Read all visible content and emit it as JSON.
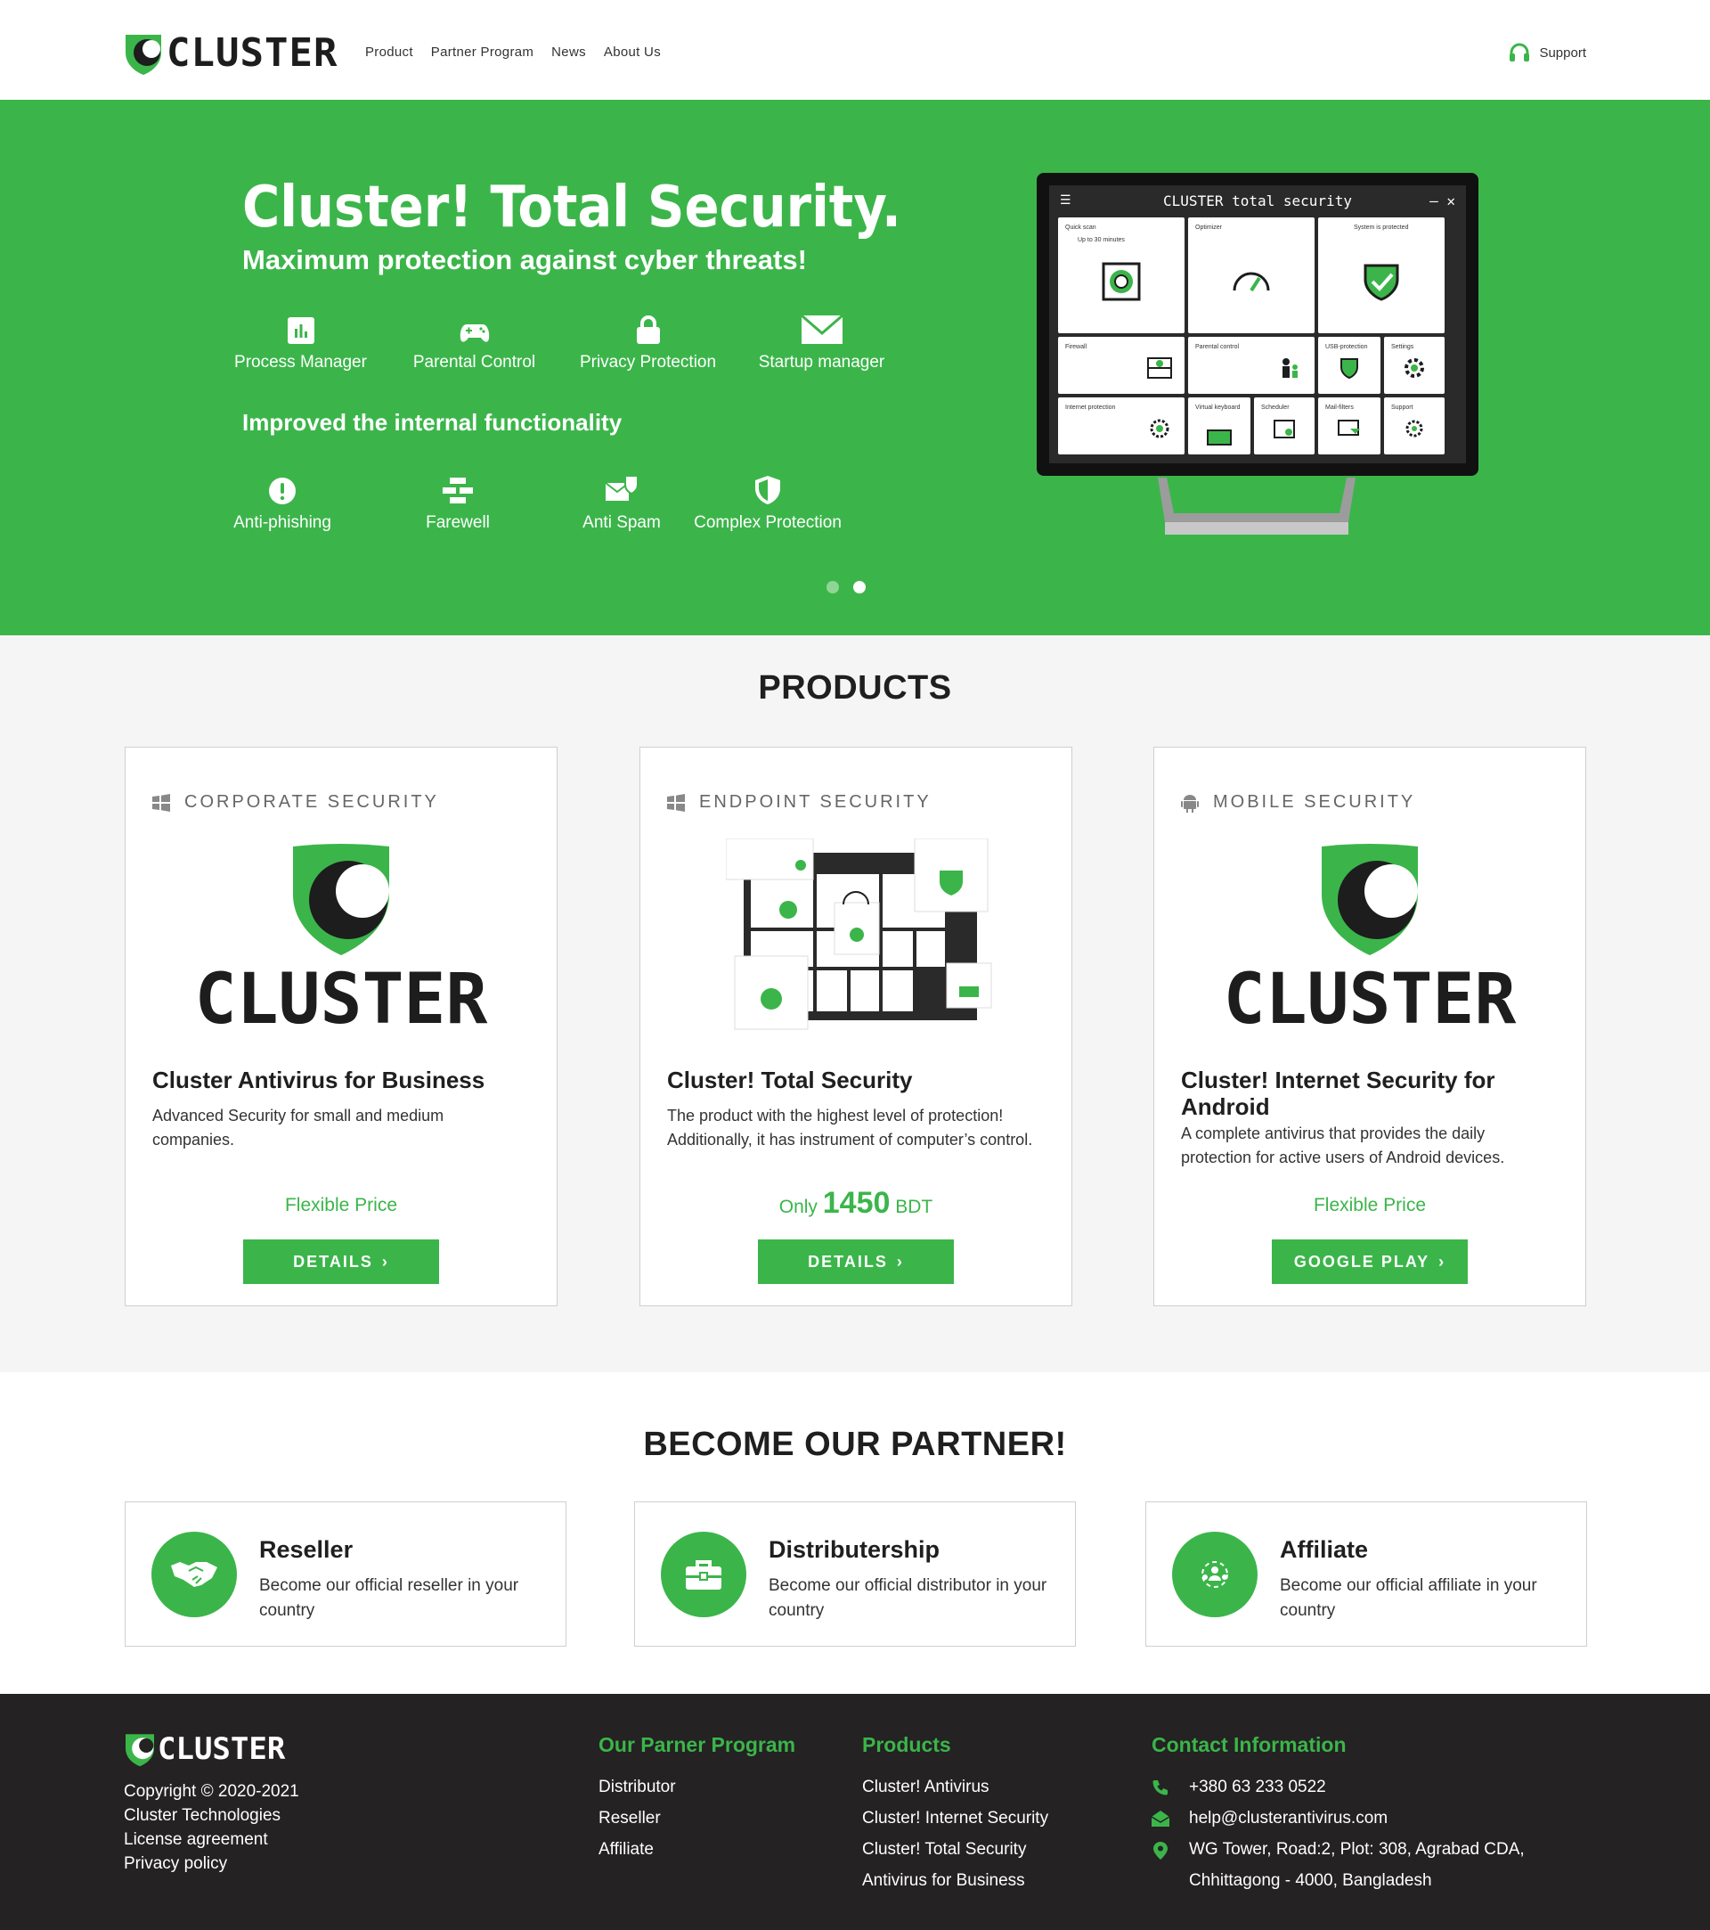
{
  "header": {
    "logo_text": "CLUSTER",
    "nav": [
      "Product",
      "Partner Program",
      "News",
      "About Us"
    ],
    "support_label": "Support"
  },
  "hero": {
    "title": "Cluster! Total Security.",
    "subtitle": "Maximum protection against cyber threats!",
    "features_top": [
      {
        "label": "Process Manager",
        "icon": "chart-icon"
      },
      {
        "label": "Parental Control",
        "icon": "gamepad-icon"
      },
      {
        "label": "Privacy Protection",
        "icon": "lock-icon"
      },
      {
        "label": "Startup manager",
        "icon": "envelope-icon"
      }
    ],
    "subtitle2": "Improved the internal functionality",
    "features_bottom": [
      {
        "label": "Anti-phishing",
        "icon": "alert-icon"
      },
      {
        "label": "Farewell",
        "icon": "firewall-icon"
      },
      {
        "label": "Anti Spam",
        "icon": "mail-shield-icon"
      },
      {
        "label": "Complex Protection",
        "icon": "shield-icon"
      }
    ],
    "monitor": {
      "title": "CLUSTER total security",
      "tiles": [
        "Quick scan",
        "Up to 30 minutes",
        "Optimizer",
        "System is protected",
        "Firewall",
        "Parental control",
        "USB-protection",
        "Settings",
        "Internet protection",
        "Virtual keyboard",
        "Scheduler",
        "Mail-filters",
        "Support"
      ]
    },
    "carousel_active": 1
  },
  "products": {
    "title": "PRODUCTS",
    "cards": [
      {
        "category": "CORPORATE SECURITY",
        "category_icon": "windows-icon",
        "name": "Cluster Antivirus for Business",
        "desc": "Advanced Security for small and medium companies.",
        "price_text": "Flexible Price",
        "button": "DETAILS"
      },
      {
        "category": "ENDPOINT SECURITY",
        "category_icon": "windows-icon",
        "name": "Cluster! Total Security",
        "desc": "The product with the highest level of protection! Additionally, it has instrument of computer’s control.",
        "price_prefix": "Only",
        "price_value": "1450",
        "price_currency": "BDT",
        "button": "DETAILS"
      },
      {
        "category": "MOBILE SECURITY",
        "category_icon": "android-icon",
        "name": "Cluster! Internet Security for Android",
        "desc": "A complete antivirus that provides the daily protection for active users of Android devices.",
        "price_text": "Flexible Price",
        "button": "GOOGLE PLAY"
      }
    ],
    "logo_text": "CLUSTER"
  },
  "partner": {
    "title": "BECOME OUR PARTNER!",
    "cards": [
      {
        "title": "Reseller",
        "desc": "Become our official reseller in your country",
        "icon": "handshake-icon"
      },
      {
        "title": "Distributership",
        "desc": "Become our official distributor in your country",
        "icon": "briefcase-icon"
      },
      {
        "title": "Affiliate",
        "desc": "Become our official affiliate in your country",
        "icon": "network-icon"
      }
    ]
  },
  "footer": {
    "logo_text": "CLUSTER",
    "copyright": [
      "Copyright © 2020-2021",
      "Cluster Technologies",
      "License agreement",
      "Privacy policy"
    ],
    "col1": {
      "title": "Our Parner Program",
      "links": [
        "Distributor",
        "Reseller",
        "Affiliate"
      ]
    },
    "col2": {
      "title": "Products",
      "links": [
        "Cluster! Antivirus",
        "Cluster! Internet Security",
        "Cluster! Total Security",
        "Antivirus for Business"
      ]
    },
    "col3": {
      "title": "Contact Information",
      "phone": "+380 63 233 0522",
      "email": "help@clusterantivirus.com",
      "address1": "WG Tower, Road:2, Plot: 308, Agrabad CDA,",
      "address2": "Chhittagong - 4000, Bangladesh"
    }
  },
  "colors": {
    "brand_green": "#3bb54a",
    "dark": "#242223",
    "light_bg": "#f5f5f5"
  }
}
